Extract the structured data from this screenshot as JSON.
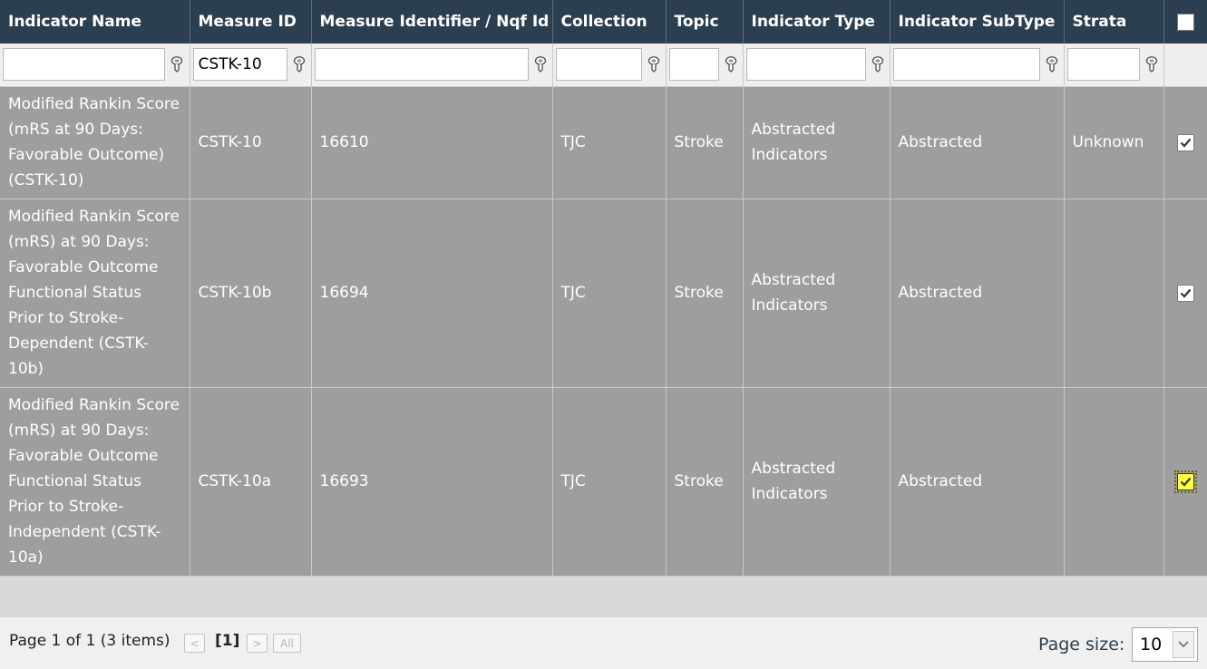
{
  "columns": [
    "Indicator Name",
    "Measure ID",
    "Measure Identifier / Nqf Id",
    "Collection",
    "Topic",
    "Indicator Type",
    "Indicator SubType",
    "Strata"
  ],
  "filters": {
    "indicator_name": "",
    "measure_id": "CSTK-10",
    "measure_identifier": "",
    "collection": "",
    "topic": "",
    "indicator_type": "",
    "indicator_subtype": "",
    "strata": ""
  },
  "rows": [
    {
      "indicator_name": "Modified Rankin Score (mRS at 90 Days: Favorable Outcome)(CSTK-10)",
      "measure_id": "CSTK-10",
      "measure_identifier": "16610",
      "collection": "TJC",
      "topic": "Stroke",
      "indicator_type": "Abstracted Indicators",
      "indicator_subtype": "Abstracted",
      "strata": "Unknown",
      "checked": true
    },
    {
      "indicator_name": "Modified Rankin Score (mRS) at 90 Days: Favorable Outcome Functional Status Prior to Stroke-Dependent (CSTK-10b)",
      "measure_id": "CSTK-10b",
      "measure_identifier": "16694",
      "collection": "TJC",
      "topic": "Stroke",
      "indicator_type": "Abstracted Indicators",
      "indicator_subtype": "Abstracted",
      "strata": "",
      "checked": true
    },
    {
      "indicator_name": "Modified Rankin Score (mRS) at 90 Days: Favorable Outcome Functional Status Prior to Stroke-Independent (CSTK-10a)",
      "measure_id": "CSTK-10a",
      "measure_identifier": "16693",
      "collection": "TJC",
      "topic": "Stroke",
      "indicator_type": "Abstracted Indicators",
      "indicator_subtype": "Abstracted",
      "strata": "",
      "checked": true
    }
  ],
  "pager": {
    "info": "Page 1 of 1 (3 items)",
    "prev": "<",
    "current": "[1]",
    "next": ">",
    "all": "All",
    "page_size_label": "Page size:",
    "page_size": "10"
  },
  "icons": {
    "filter": "filter-icon",
    "checkbox": "checkbox-icon",
    "dropdown": "chevron-down-icon"
  },
  "colors": {
    "header_bg": "#2b3f51",
    "row_bg": "#9e9e9e",
    "focus_checkbox": "#ffff33"
  }
}
